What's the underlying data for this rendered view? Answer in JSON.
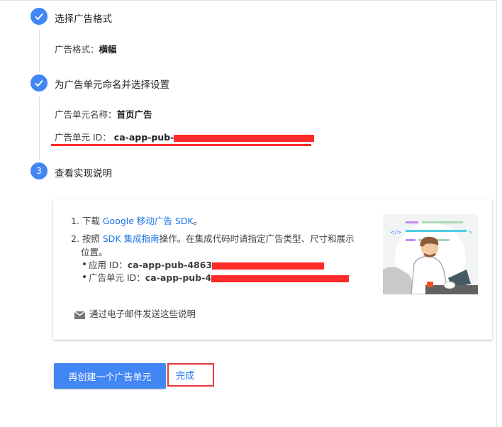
{
  "steps": [
    {
      "icon": "check-icon",
      "title": "选择广告格式"
    },
    {
      "icon": "check-icon",
      "title": "为广告单元命名并选择设置"
    },
    {
      "number": "3",
      "title": "查看实现说明"
    }
  ],
  "step1": {
    "format_label": "广告格式：",
    "format_value": "横幅"
  },
  "step2": {
    "name_label": "广告单元名称：",
    "name_value": "首页广告",
    "id_label": "广告单元 ID：",
    "id_value": "ca-app-pub-"
  },
  "instructions": {
    "item1_prefix": "1. 下载 ",
    "item1_link": "Google 移动广告 SDK",
    "item1_suffix": "。",
    "item2_prefix": "2. 按照 ",
    "item2_link": "SDK 集成指南",
    "item2_suffix": "操作。在集成代码时请指定广告类型、尺寸和展示",
    "item2_cont": "位置。",
    "app_id_label": "应用 ID：",
    "app_id_value": "ca-app-pub-4863",
    "unit_id_label": "广告单元 ID：",
    "unit_id_value": "ca-app-pub-4",
    "email_link": "通过电子邮件发送这些说明"
  },
  "buttons": {
    "create_another": "再创建一个广告单元",
    "done": "完成"
  },
  "colors": {
    "primary": "#4285f4",
    "link": "#1a73e8",
    "redaction": "#ff2a2a",
    "highlight_border": "#e53935"
  }
}
